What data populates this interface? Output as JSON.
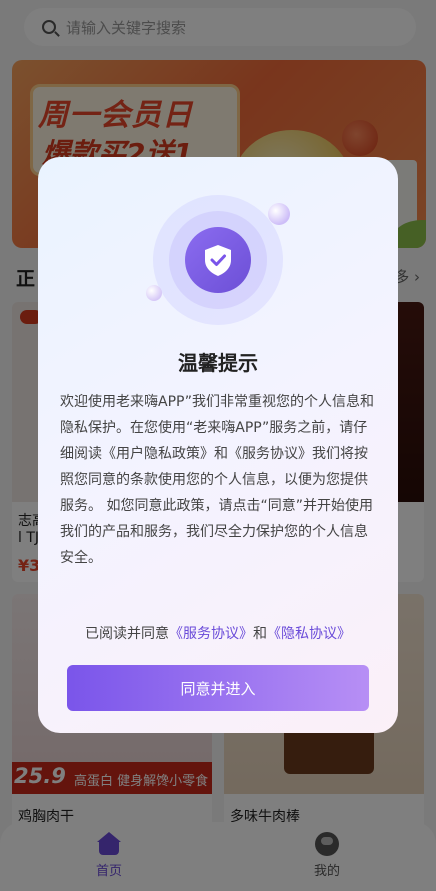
{
  "search": {
    "placeholder": "请输入关键字搜索"
  },
  "banner": {
    "title": "周一会员日",
    "subtitle": "爆款买2送1"
  },
  "section": {
    "title": "正",
    "more": "多 ›"
  },
  "products": [
    {
      "name_line1": "志高",
      "name_line2": "l TJ",
      "price": "¥3"
    },
    {
      "name": ""
    },
    {
      "price": "25.9",
      "tagline": "高蛋白 健身解馋小零食",
      "name": "鸡胸肉干"
    },
    {
      "name": "多味牛肉棒"
    }
  ],
  "tabbar": {
    "items": [
      {
        "label": "首页",
        "icon": "home-icon",
        "active": true
      },
      {
        "label": "我的",
        "icon": "user-icon",
        "active": false
      }
    ]
  },
  "dialog": {
    "icon": "shield-check-icon",
    "title": "温馨提示",
    "body": "欢迎使用老来嗨APP”我们非常重视您的个人信息和隐私保护。在您使用“老来嗨APP”服务之前，请仔细阅读《用户隐私政策》和《服务协议》我们将按照您同意的条款使用您的个人信息，以便为您提供服务。 如您同意此政策，请点击“同意”并开始使用我们的产品和服务，我们尽全力保护您的个人信息安全。",
    "consent_prefix": "已阅读并同意",
    "service_link": "《服务协议》",
    "consent_and": "和",
    "privacy_link": "《隐私协议》",
    "button": "同意并进入"
  },
  "colors": {
    "accent": "#6a4bd9",
    "button_start": "#7a55ea",
    "button_end": "#b78ff5"
  }
}
